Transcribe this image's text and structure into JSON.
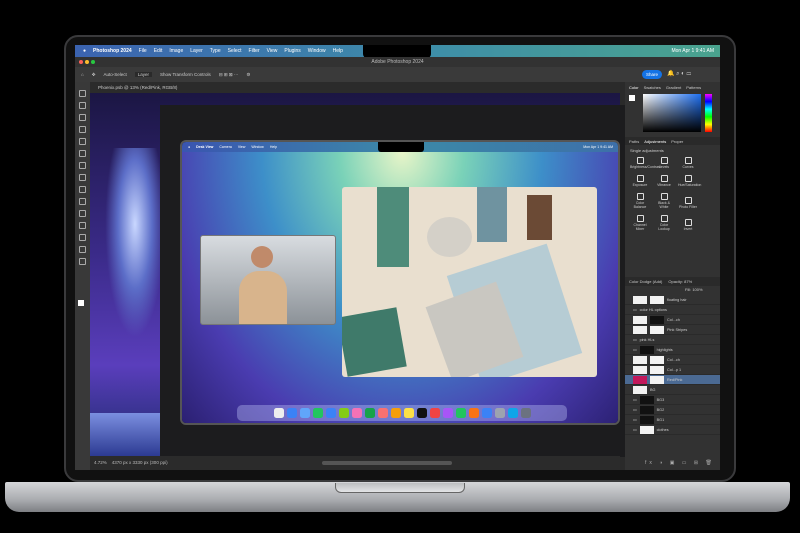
{
  "menubar": {
    "app": "Photoshop 2024",
    "items": [
      "File",
      "Edit",
      "Image",
      "Layer",
      "Type",
      "Select",
      "Filter",
      "View",
      "Plugins",
      "Window",
      "Help"
    ],
    "clock": "Mon Apr 1  9:41 AM"
  },
  "window": {
    "title": "Adobe Photoshop 2024"
  },
  "options": {
    "auto_select": "Auto-Select",
    "layer_select": "Layer",
    "transform": "Show Transform Controls",
    "share": "Share"
  },
  "document": {
    "tab": "Phoenix.psb @ 13% (Red/Pink, RGB/8)",
    "zoom": "4.72%",
    "dimensions": "4370 px x 3330 px (300 ppi)"
  },
  "panels": {
    "color_tabs": [
      "Color",
      "Swatches",
      "Gradient",
      "Patterns"
    ],
    "adj_tabs": [
      "Paths",
      "Adjustments",
      "Proper"
    ],
    "adj_title": "Single adjustments",
    "adjustments": [
      "Brightness/Contrast",
      "Levels",
      "Curves",
      "Exposure",
      "Vibrance",
      "Hue/Saturation",
      "Color Balance",
      "Black & White",
      "Photo Filter",
      "Channel Mixer",
      "Color Lookup",
      "Invert"
    ],
    "blend": "Color Dodge (Add)",
    "opacity": "Opacity: 87%",
    "fill": "Fill: 100%",
    "layers": [
      "floating hair",
      "color HL options",
      "Col...ch",
      "Pink Stripes",
      "pink HLs",
      "highlights",
      "Col...ch",
      "Col...p 1",
      "Red/Pink",
      "BG",
      "BG3",
      "BG2",
      "BG1",
      "clothes"
    ]
  },
  "desk_view": {
    "menu": [
      "Desk View",
      "Camera",
      "View",
      "Window",
      "Help"
    ],
    "clock": "Mon Apr 1  9:41 AM"
  },
  "colors": {
    "accent": "#1473e6",
    "selected_layer": "#4b6a93"
  }
}
